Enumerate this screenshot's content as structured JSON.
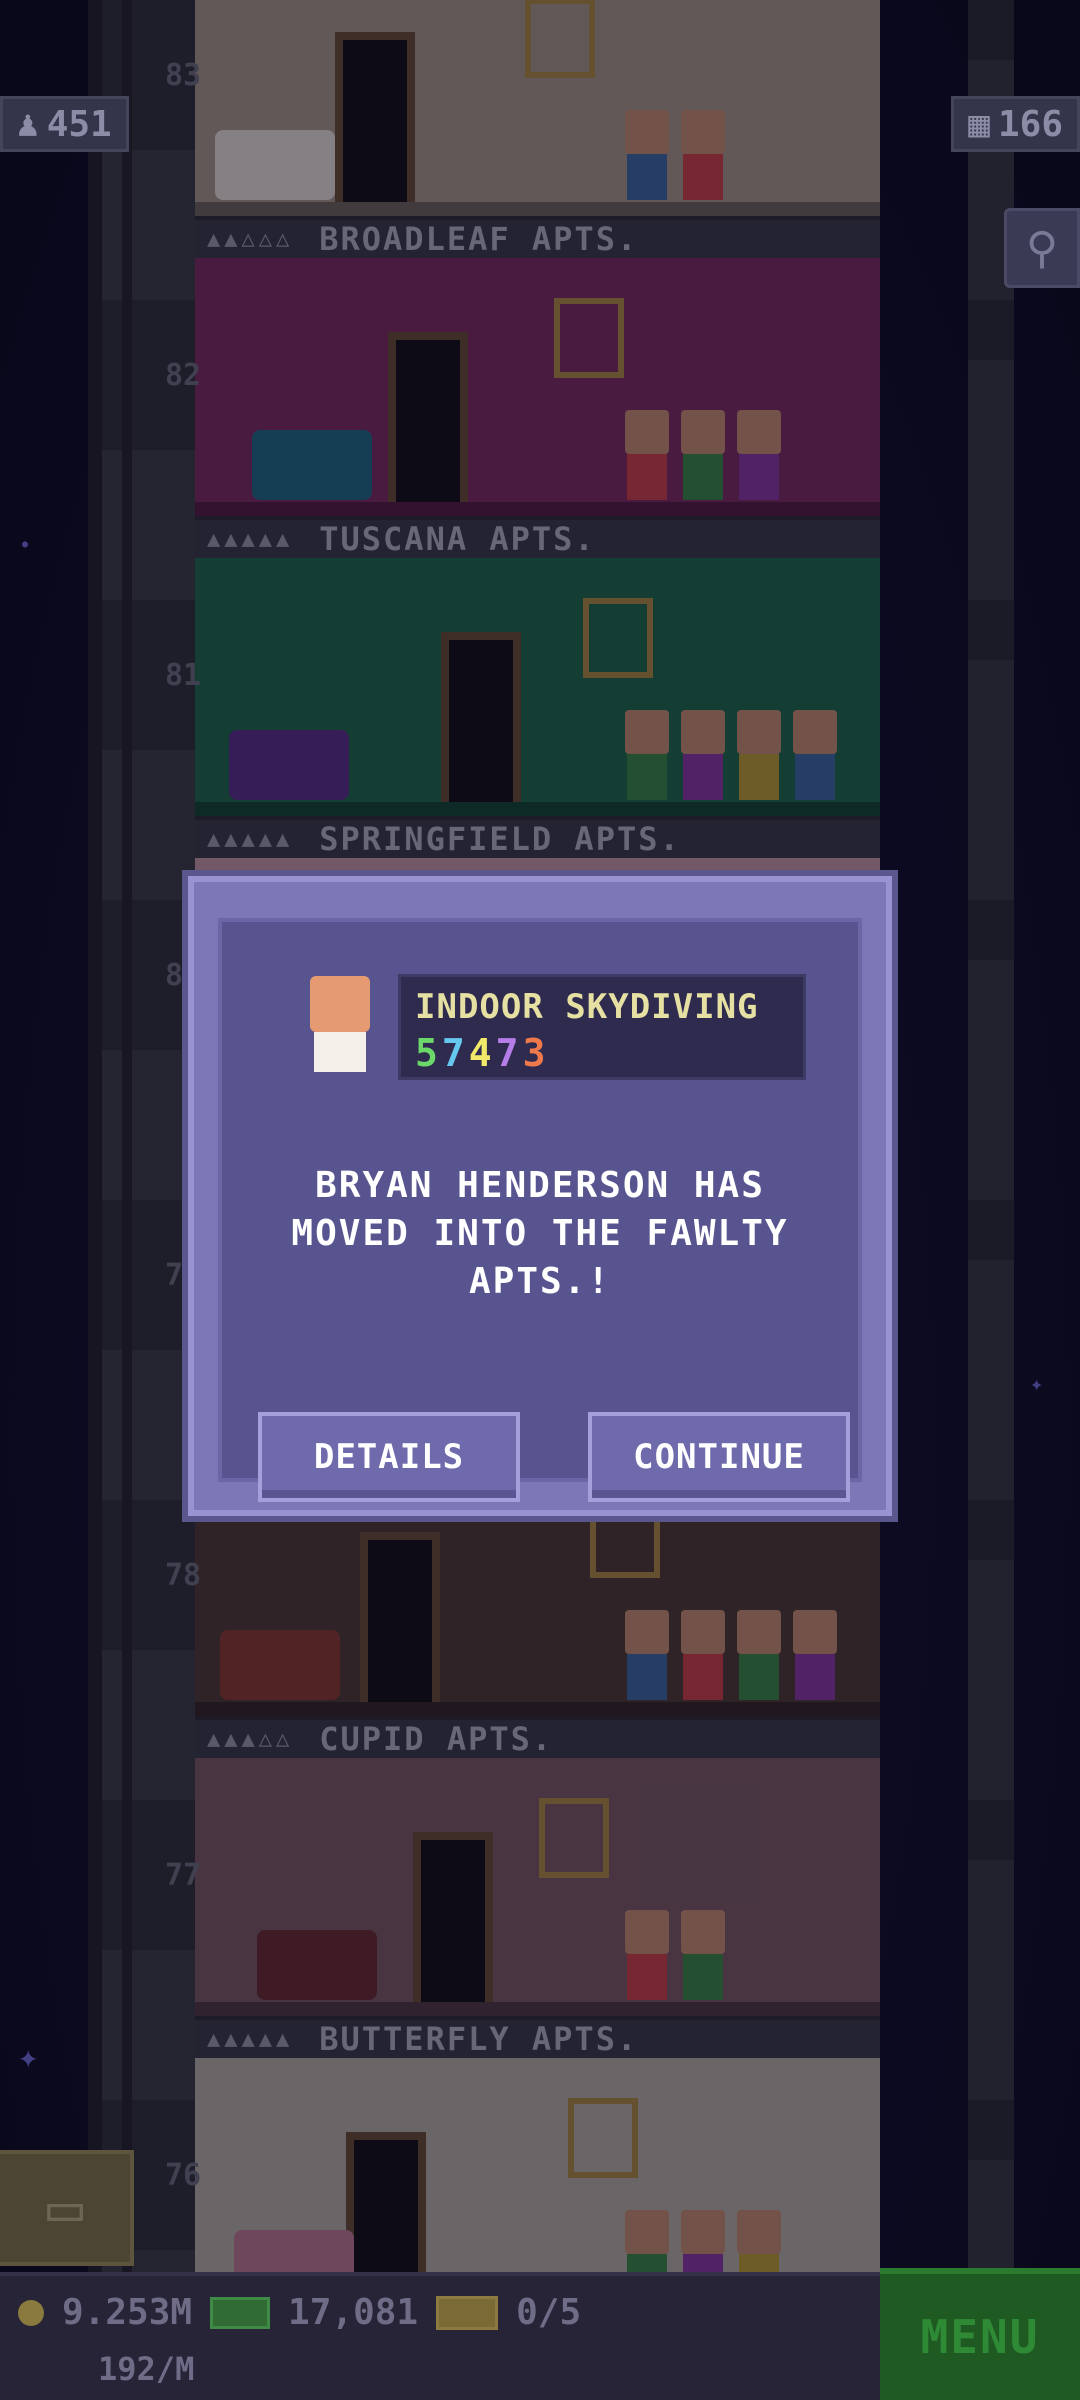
{
  "hud": {
    "population": "451",
    "population_icon": "person-icon",
    "floors": "166",
    "floors_icon": "building-icon",
    "search_icon": "magnifier-icon"
  },
  "floors": [
    {
      "name": "BROADLEAF APTS.",
      "num": "83",
      "room_color": "#a99a86",
      "stars_filled": 2
    },
    {
      "name": "TUSCANA APTS.",
      "num": "82",
      "room_color": "#7e2a5e",
      "stars_filled": 5
    },
    {
      "name": "SPRINGFIELD APTS.",
      "num": "81",
      "room_color": "#1c6a44",
      "stars_filled": 5
    },
    {
      "name": "",
      "num": "80",
      "room_color": "#c99aa0",
      "stars_filled": 0
    },
    {
      "name": "",
      "num": "79",
      "room_color": "#9f9a7c",
      "stars_filled": 0
    },
    {
      "name": "CUPID APTS.",
      "num": "78",
      "room_color": "#4d3a2e",
      "stars_filled": 3
    },
    {
      "name": "BUTTERFLY APTS.",
      "num": "77",
      "room_color": "#7a5a5e",
      "stars_filled": 5
    },
    {
      "name": "",
      "num": "76",
      "room_color": "#b9b2a4",
      "stars_filled": 0
    }
  ],
  "dialog": {
    "job_title": "INDOOR SKYDIVING",
    "job_number": [
      "5",
      "7",
      "4",
      "7",
      "3"
    ],
    "message": "BRYAN HENDERSON HAS MOVED INTO THE FAWLTY APTS.!",
    "details_label": "DETAILS",
    "continue_label": "CONTINUE"
  },
  "bottom": {
    "coins": "9.253M",
    "bux": "17,081",
    "tickets": "0/5",
    "rate": "192/M",
    "menu_label": "MENU",
    "box_icon": "storage-box-icon"
  }
}
